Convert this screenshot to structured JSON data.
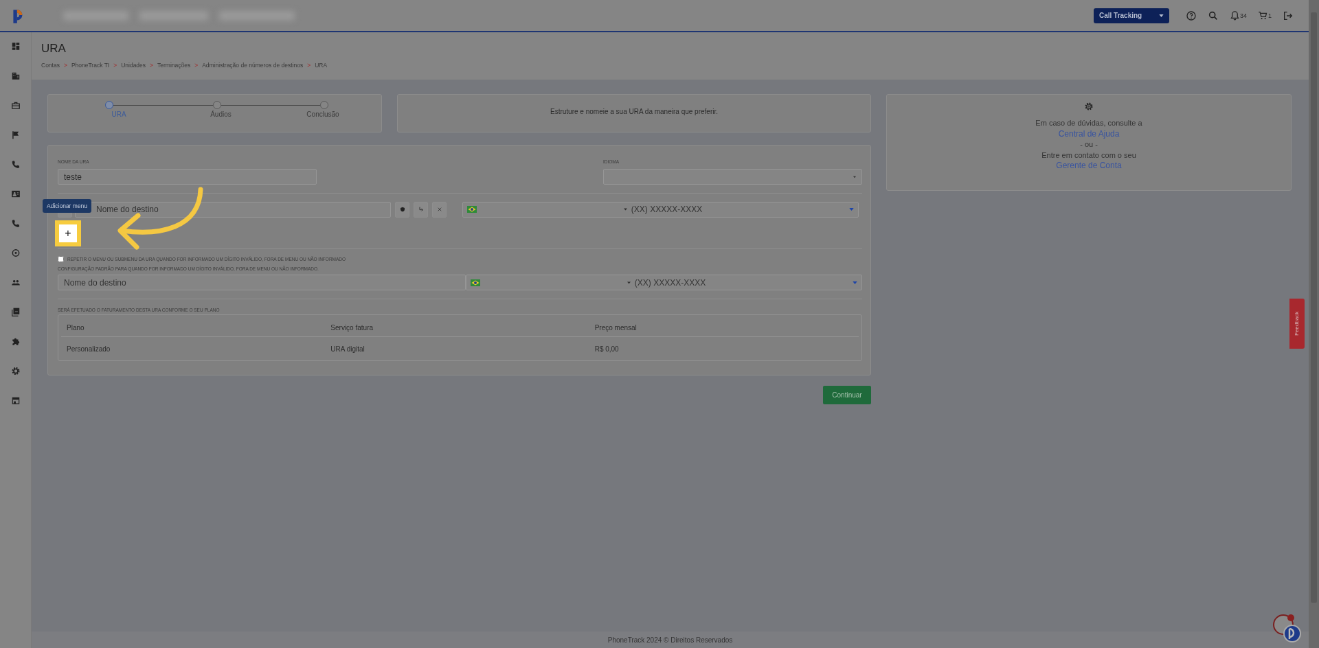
{
  "header": {
    "product_select": "Call Tracking",
    "notification_count": "34",
    "cart_count": "1"
  },
  "page": {
    "title": "URA",
    "breadcrumb": [
      {
        "label": "Contas",
        "separator": ">"
      },
      {
        "label": "PhoneTrack TI",
        "separator": ">"
      },
      {
        "label": "Unidades",
        "separator": ">"
      },
      {
        "label": "Terminações",
        "separator": ">"
      },
      {
        "label": "Administração de números de destinos",
        "separator": ">"
      },
      {
        "label": "URA"
      }
    ]
  },
  "stepper": {
    "steps": [
      {
        "label": "URA",
        "selected": true
      },
      {
        "label": "Áudios",
        "selected": false
      },
      {
        "label": "Conclusão",
        "selected": false
      }
    ]
  },
  "intro_text": "Estruture e nomeie a sua URA da maneira que preferir.",
  "help": {
    "lines": [
      {
        "kind": "text",
        "text": "Em caso de dúvidas, consulte a"
      },
      {
        "kind": "link",
        "text": "Central de Ajuda"
      },
      {
        "kind": "text",
        "text": "- ou -"
      },
      {
        "kind": "text",
        "text": "Entre em contato com o seu"
      },
      {
        "kind": "link",
        "text": "Gerente de Conta"
      }
    ]
  },
  "form": {
    "name": {
      "label": "NOME DA URA",
      "value": "teste"
    },
    "language": {
      "label": "IDIOMA"
    },
    "menu_options": [
      {
        "destination_placeholder": "Nome do destino",
        "phone_placeholder": "(XX) XXXXX-XXXX"
      }
    ],
    "add_menu": {
      "label": "+",
      "tooltip": "Adicionar menu",
      "highlighted": true
    },
    "repeat_option": {
      "label": "REPETIR O MENU OU SUBMENU DA URA QUANDO FOR INFORMADO UM DÍGITO INVÁLIDO, FORA DE MENU OU NÃO INFORMADO",
      "checked": false
    },
    "default_config": {
      "label": "CONFIGURAÇÃO PADRÃO PARA QUANDO FOR INFORMADO UM DÍGITO INVÁLIDO, FORA DE MENU OU NÃO INFORMADO.",
      "destination_placeholder": "Nome do destino",
      "phone_placeholder": "(XX) XXXXX-XXXX"
    },
    "billing": {
      "label": "SERÁ EFETUADO O FATURAMENTO DESTA URA CONFORME O SEU PLANO",
      "columns": [
        "Plano",
        "Serviço fatura",
        "Preço mensal"
      ],
      "rows": [
        [
          "Personalizado",
          "URA digital",
          "R$ 0,00"
        ]
      ]
    }
  },
  "continue_button": "Continuar",
  "footer": "PhoneTrack 2024 © Direitos Reservados",
  "feedback_tab": "Feedback"
}
